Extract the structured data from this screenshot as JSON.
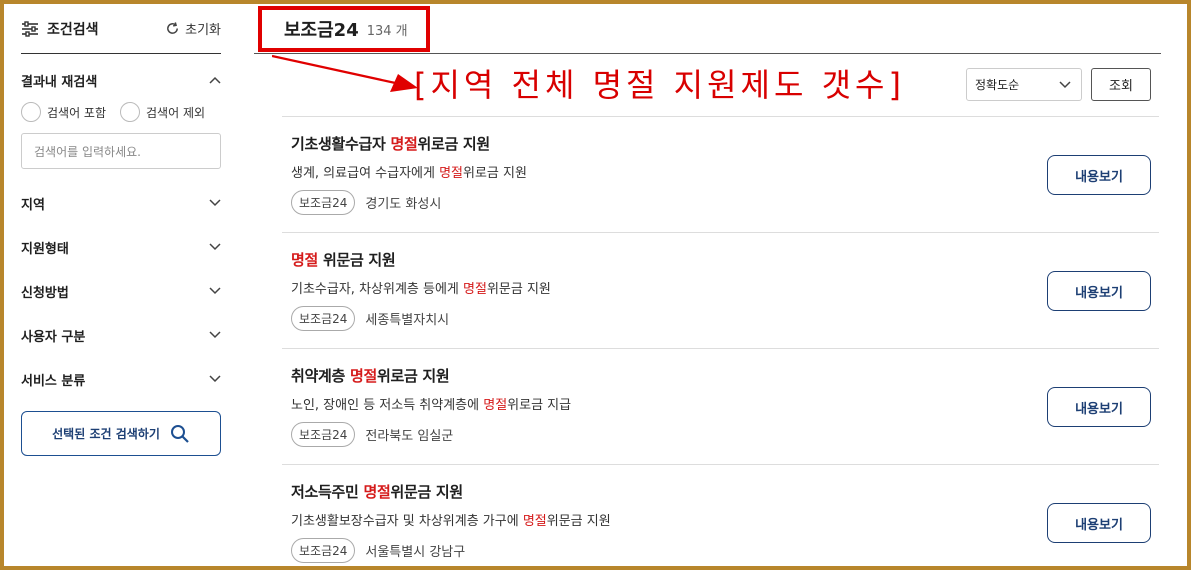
{
  "sidebar": {
    "header_label": "조건검색",
    "reset_label": "초기화",
    "research": {
      "title": "결과내 재검색",
      "include_label": "검색어 포함",
      "exclude_label": "검색어 제외",
      "placeholder": "검색어를 입력하세요."
    },
    "filters": [
      "지역",
      "지원형태",
      "신청방법",
      "사용자 구분",
      "서비스 분류"
    ],
    "search_button": "선택된 조건 검색하기"
  },
  "main": {
    "title": "보조금24",
    "count": "134 개",
    "annotation": "[지역 전체 명절 지원제도 갯수]",
    "sort_value": "정확도순",
    "query_label": "조회",
    "view_label": "내용보기",
    "items": [
      {
        "title_pre": "기초생활수급자 ",
        "title_hl": "명절",
        "title_post": "위로금 지원",
        "desc_pre": "생계, 의료급여 수급자에게 ",
        "desc_hl": "명절",
        "desc_post": "위로금 지원",
        "tag": "보조금24",
        "region": "경기도 화성시"
      },
      {
        "title_pre": "",
        "title_hl": "명절",
        "title_post": " 위문금 지원",
        "desc_pre": "기초수급자, 차상위계층 등에게 ",
        "desc_hl": "명절",
        "desc_post": "위문금 지원",
        "tag": "보조금24",
        "region": "세종특별자치시"
      },
      {
        "title_pre": "취약계층 ",
        "title_hl": "명절",
        "title_post": "위로금 지원",
        "desc_pre": "노인, 장애인 등 저소득 취약계층에 ",
        "desc_hl": "명절",
        "desc_post": "위로금 지급",
        "tag": "보조금24",
        "region": "전라북도 임실군"
      },
      {
        "title_pre": "저소득주민 ",
        "title_hl": "명절",
        "title_post": "위문금 지원",
        "desc_pre": "기초생활보장수급자 및 차상위계층 가구에 ",
        "desc_hl": "명절",
        "desc_post": "위문금 지원",
        "tag": "보조금24",
        "region": "서울특별시 강남구"
      }
    ]
  },
  "colors": {
    "highlight": "#d51a1a",
    "accent": "#1d3f74",
    "annotation": "#d80000",
    "frame": "#b8862b"
  }
}
